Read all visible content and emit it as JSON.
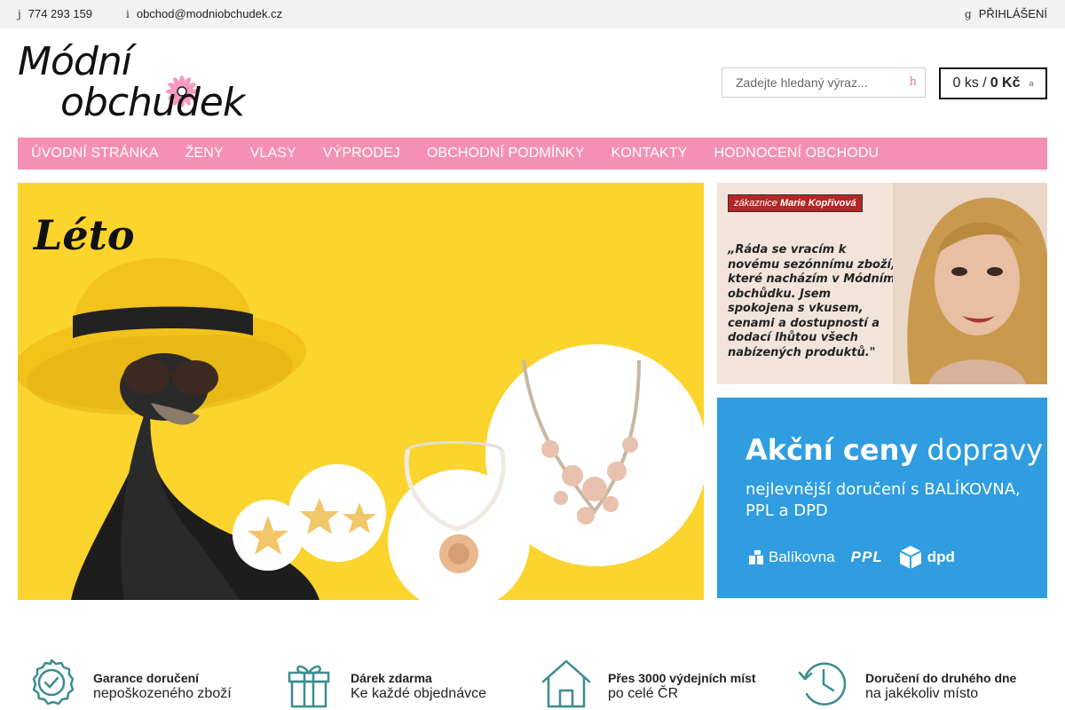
{
  "topbar": {
    "phone_icon": "j",
    "phone": "774 293 159",
    "email_icon": "i",
    "email": "obchod@modniobchudek.cz",
    "login_icon": "g",
    "login": "PŘIHLÁŠENÍ"
  },
  "logo": {
    "line1": "Módní",
    "line2": "obchudek"
  },
  "search": {
    "placeholder": "Zadejte hledaný výraz...",
    "icon": "h"
  },
  "cart": {
    "qty": "0 ks /",
    "price": "0 Kč",
    "icon": "a"
  },
  "nav": [
    {
      "label": "ÚVODNÍ STRÁNKA"
    },
    {
      "label": "ŽENY"
    },
    {
      "label": "VLASY"
    },
    {
      "label": "VÝPRODEJ"
    },
    {
      "label": "OBCHODNÍ PODMÍNKY"
    },
    {
      "label": "KONTAKTY"
    },
    {
      "label": "HODNOCENÍ OBCHODU"
    }
  ],
  "hero": {
    "script_title": "Léto",
    "background_color": "#fbd42d"
  },
  "testimonial": {
    "badge_prefix": "zákaznice",
    "badge_name": "Marie Kopřivová",
    "quote": "„Ráda se vracím k novému sezónnímu zboží, které nacházím v Módním obchůdku. Jsem spokojena s vkusem, cenami a dostupností a dodací lhůtou všech nabízených produktů.\""
  },
  "shipping": {
    "title_bold": "Akční ceny",
    "title_rest": "dopravy",
    "subtitle": "nejlevnější doručení s BALÍKOVNA, PPL a DPD",
    "carriers": [
      "Balíkovna",
      "PPL",
      "dpd"
    ],
    "background_color": "#2f9de0"
  },
  "features": [
    {
      "icon": "shield-check-icon",
      "title": "Garance doručení",
      "subtitle": "nepoškozeného zboží"
    },
    {
      "icon": "gift-icon",
      "title": "Dárek zdarma",
      "subtitle": "Ke každé objednávce"
    },
    {
      "icon": "home-icon",
      "title": "Přes 3000 výdejních míst",
      "subtitle": "po celé ČR"
    },
    {
      "icon": "history-clock-icon",
      "title": "Doručení do druhého dne",
      "subtitle": "na jakékoliv místo"
    }
  ],
  "colors": {
    "nav": "#f590b4",
    "icon_teal": "#3a8d8f",
    "accent_pink": "#e0799f"
  }
}
